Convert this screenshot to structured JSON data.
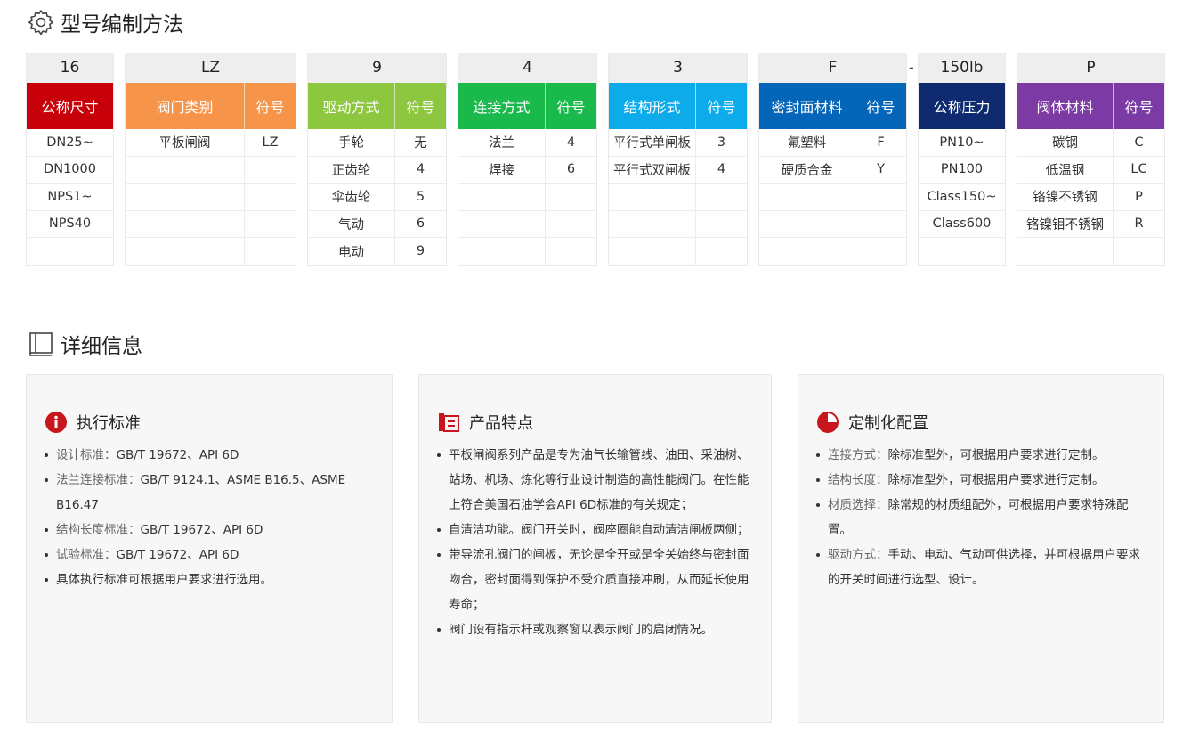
{
  "sections": {
    "model_title": "型号编制方法",
    "detail_title": "详细信息"
  },
  "model": {
    "separator": "-",
    "columns": [
      {
        "code": "16",
        "header": "公称尺寸",
        "symbol_header": "",
        "color": "#c8000a",
        "rows": [
          [
            "DN25~",
            ""
          ],
          [
            "DN1000",
            ""
          ],
          [
            "NPS1~",
            ""
          ],
          [
            "NPS40",
            ""
          ],
          [
            "",
            ""
          ]
        ]
      },
      {
        "code": "LZ",
        "header": "阀门类别",
        "symbol_header": "符号",
        "color": "#f6954a",
        "rows": [
          [
            "平板闸阀",
            "LZ"
          ],
          [
            "",
            ""
          ],
          [
            "",
            ""
          ],
          [
            "",
            ""
          ],
          [
            "",
            ""
          ]
        ]
      },
      {
        "code": "9",
        "header": "驱动方式",
        "symbol_header": "符号",
        "color": "#8dc63f",
        "rows": [
          [
            "手轮",
            "无"
          ],
          [
            "正齿轮",
            "4"
          ],
          [
            "伞齿轮",
            "5"
          ],
          [
            "气动",
            "6"
          ],
          [
            "电动",
            "9"
          ]
        ]
      },
      {
        "code": "4",
        "header": "连接方式",
        "symbol_header": "符号",
        "color": "#19b94c",
        "rows": [
          [
            "法兰",
            "4"
          ],
          [
            "焊接",
            "6"
          ],
          [
            "",
            ""
          ],
          [
            "",
            ""
          ],
          [
            "",
            ""
          ]
        ]
      },
      {
        "code": "3",
        "header": "结构形式",
        "symbol_header": "符号",
        "color": "#0dabea",
        "rows": [
          [
            "平行式单闸板",
            "3"
          ],
          [
            "平行式双闸板",
            "4"
          ],
          [
            "",
            ""
          ],
          [
            "",
            ""
          ],
          [
            "",
            ""
          ]
        ]
      },
      {
        "code": "F",
        "header": "密封面材料",
        "symbol_header": "符号",
        "color": "#0565b9",
        "rows": [
          [
            "氟塑料",
            "F"
          ],
          [
            "硬质合金",
            "Y"
          ],
          [
            "",
            ""
          ],
          [
            "",
            ""
          ],
          [
            "",
            ""
          ]
        ]
      },
      {
        "code": "150lb",
        "header": "公称压力",
        "symbol_header": "",
        "color": "#0f2a6e",
        "rows": [
          [
            "PN10~",
            ""
          ],
          [
            "PN100",
            ""
          ],
          [
            "Class150~",
            ""
          ],
          [
            "Class600",
            ""
          ],
          [
            "",
            ""
          ]
        ]
      },
      {
        "code": "P",
        "header": "阀体材料",
        "symbol_header": "符号",
        "color": "#7b3aa4",
        "rows": [
          [
            "碳钢",
            "C"
          ],
          [
            "低温钢",
            "LC"
          ],
          [
            "铬镍不锈钢",
            "P"
          ],
          [
            "铬镍钼不锈钢",
            "R"
          ],
          [
            "",
            ""
          ]
        ]
      }
    ]
  },
  "cards": [
    {
      "title": "执行标准",
      "icon": "info-icon",
      "items": [
        {
          "key": "设计标准：",
          "text": "GB/T 19672、API 6D"
        },
        {
          "key": "法兰连接标准：",
          "text": "GB/T 9124.1、ASME B16.5、ASME B16.47"
        },
        {
          "key": "结构长度标准：",
          "text": "GB/T 19672、API 6D"
        },
        {
          "key": "试验标准：",
          "text": "GB/T 19672、API 6D"
        },
        {
          "key": "",
          "text": "具体执行标准可根据用户要求进行选用。"
        }
      ]
    },
    {
      "title": "产品特点",
      "icon": "document-icon",
      "items": [
        {
          "key": "",
          "text": "平板闸阀系列产品是专为油气长输管线、油田、采油树、站场、机场、炼化等行业设计制造的高性能阀门。在性能上符合美国石油学会API 6D标准的有关规定；"
        },
        {
          "key": "",
          "text": "自清洁功能。阀门开关时，阀座圈能自动清洁闸板两侧；"
        },
        {
          "key": "",
          "text": "带导流孔阀门的闸板，无论是全开或是全关始终与密封面吻合，密封面得到保护不受介质直接冲刷，从而延长使用寿命；"
        },
        {
          "key": "",
          "text": "阀门设有指示杆或观察窗以表示阀门的启闭情况。"
        }
      ]
    },
    {
      "title": "定制化配置",
      "icon": "pie-chart-icon",
      "items": [
        {
          "key": "连接方式：",
          "text": "除标准型外，可根据用户要求进行定制。"
        },
        {
          "key": "结构长度：",
          "text": "除标准型外，可根据用户要求进行定制。"
        },
        {
          "key": "材质选择：",
          "text": "除常规的材质组配外，可根据用户要求特殊配置。"
        },
        {
          "key": "驱动方式：",
          "text": "手动、电动、气动可供选择，并可根据用户要求的开关时间进行选型、设计。"
        }
      ]
    }
  ],
  "colors": {
    "accent_red": "#c8161d"
  }
}
